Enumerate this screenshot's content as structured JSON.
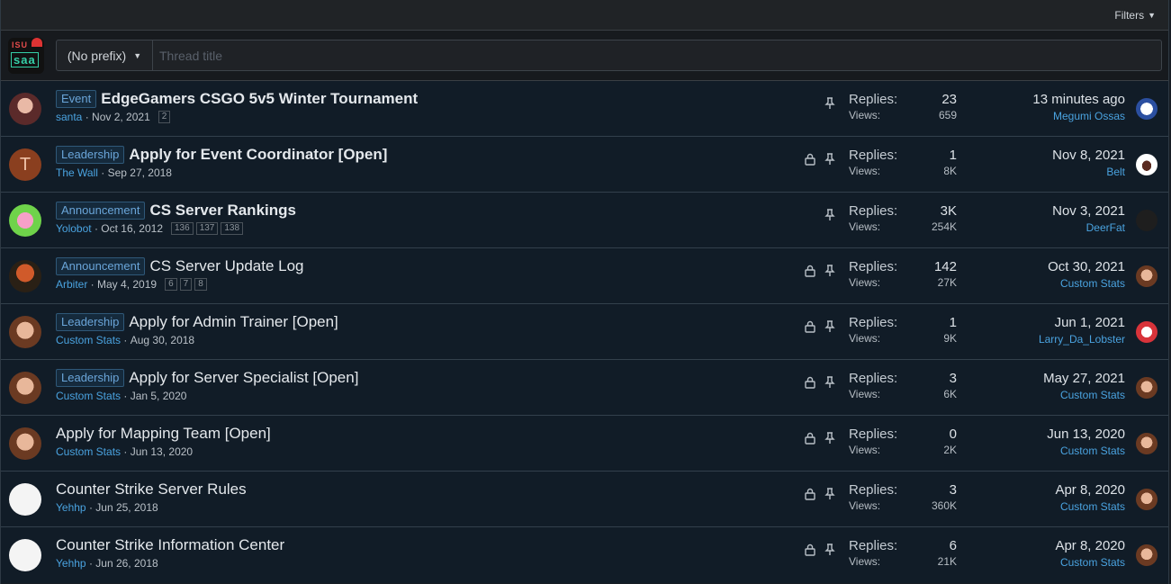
{
  "filters": {
    "label": "Filters"
  },
  "new_thread": {
    "logo_text_top": "ISU",
    "logo_text_bottom": "saa",
    "prefix": "(No prefix)",
    "title_placeholder": "Thread title"
  },
  "labels": {
    "replies": "Replies:",
    "views": "Views:"
  },
  "threads": [
    {
      "prefix": "Event",
      "title": "EdgeGamers CSGO 5v5 Winter Tournament",
      "bold": true,
      "author": "santa",
      "date": "Nov 2, 2021",
      "pages": [
        "2"
      ],
      "locked": false,
      "pinned": true,
      "replies": "23",
      "views": "659",
      "last_date": "13 minutes ago",
      "last_user": "Megumi Ossas"
    },
    {
      "prefix": "Leadership",
      "title": "Apply for Event Coordinator [Open]",
      "bold": true,
      "author": "The Wall",
      "date": "Sep 27, 2018",
      "pages": [],
      "locked": true,
      "pinned": true,
      "replies": "1",
      "views": "8K",
      "last_date": "Nov 8, 2021",
      "last_user": "Belt",
      "avatar_letter": "T"
    },
    {
      "prefix": "Announcement",
      "title": "CS Server Rankings",
      "bold": true,
      "author": "Yolobot",
      "date": "Oct 16, 2012",
      "pages": [
        "136",
        "137",
        "138"
      ],
      "locked": false,
      "pinned": true,
      "replies": "3K",
      "views": "254K",
      "last_date": "Nov 3, 2021",
      "last_user": "DeerFat"
    },
    {
      "prefix": "Announcement",
      "title": "CS Server Update Log",
      "bold": false,
      "author": "Arbiter",
      "date": "May 4, 2019",
      "pages": [
        "6",
        "7",
        "8"
      ],
      "locked": true,
      "pinned": true,
      "replies": "142",
      "views": "27K",
      "last_date": "Oct 30, 2021",
      "last_user": "Custom Stats"
    },
    {
      "prefix": "Leadership",
      "title": "Apply for Admin Trainer [Open]",
      "bold": false,
      "author": "Custom Stats",
      "date": "Aug 30, 2018",
      "pages": [],
      "locked": true,
      "pinned": true,
      "replies": "1",
      "views": "9K",
      "last_date": "Jun 1, 2021",
      "last_user": "Larry_Da_Lobster"
    },
    {
      "prefix": "Leadership",
      "title": "Apply for Server Specialist [Open]",
      "bold": false,
      "author": "Custom Stats",
      "date": "Jan 5, 2020",
      "pages": [],
      "locked": true,
      "pinned": true,
      "replies": "3",
      "views": "6K",
      "last_date": "May 27, 2021",
      "last_user": "Custom Stats"
    },
    {
      "prefix": "",
      "title": "Apply for Mapping Team [Open]",
      "bold": false,
      "author": "Custom Stats",
      "date": "Jun 13, 2020",
      "pages": [],
      "locked": true,
      "pinned": true,
      "replies": "0",
      "views": "2K",
      "last_date": "Jun 13, 2020",
      "last_user": "Custom Stats"
    },
    {
      "prefix": "",
      "title": "Counter Strike Server Rules",
      "bold": false,
      "author": "Yehhp",
      "date": "Jun 25, 2018",
      "pages": [],
      "locked": true,
      "pinned": true,
      "replies": "3",
      "views": "360K",
      "last_date": "Apr 8, 2020",
      "last_user": "Custom Stats"
    },
    {
      "prefix": "",
      "title": "Counter Strike Information Center",
      "bold": false,
      "author": "Yehhp",
      "date": "Jun 26, 2018",
      "pages": [],
      "locked": true,
      "pinned": true,
      "replies": "6",
      "views": "21K",
      "last_date": "Apr 8, 2020",
      "last_user": "Custom Stats"
    }
  ],
  "colors": {
    "link": "#4aa3e0",
    "background": "#111c27",
    "label_bg": "#152a3c"
  }
}
